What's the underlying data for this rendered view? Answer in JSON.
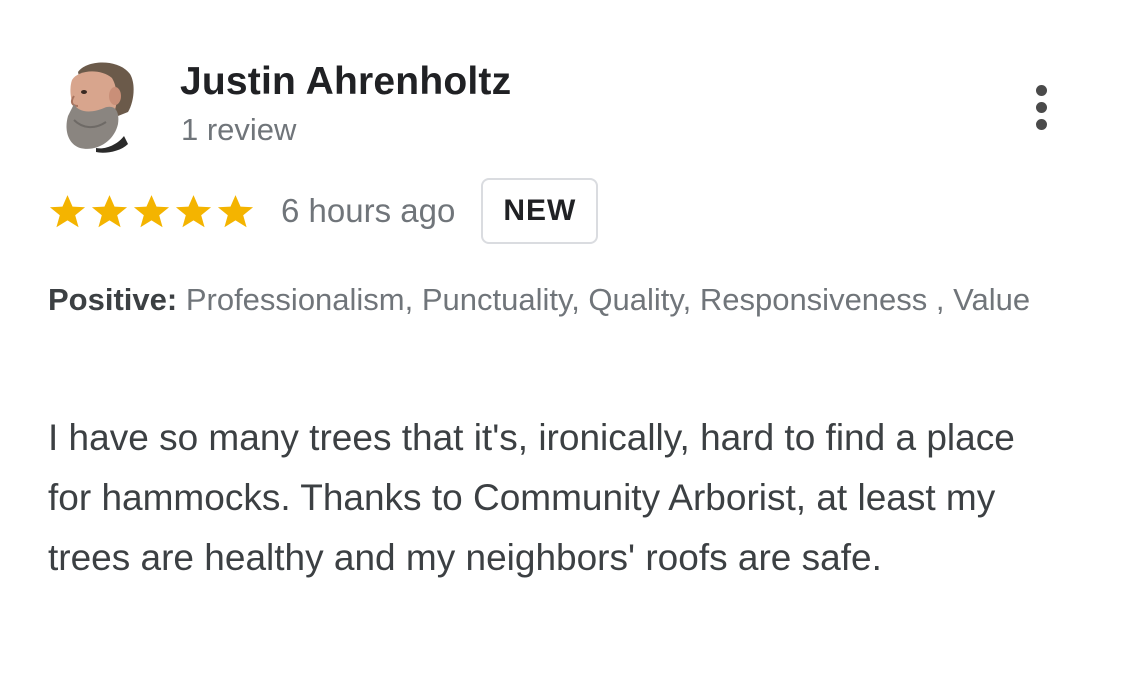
{
  "reviewer": {
    "name": "Justin Ahrenholtz",
    "review_count": "1 review"
  },
  "rating": {
    "stars": 5,
    "max_stars": 5,
    "star_color": "#f4b400",
    "time": "6 hours ago",
    "badge": "NEW"
  },
  "attributes": {
    "label": "Positive:",
    "values": " Professionalism, Punctuality, Quality, Responsiveness , Value"
  },
  "review": {
    "text": "I have so many trees that it's, ironically, hard to find a place for hammocks. Thanks to Community Arborist, at least my trees are healthy and my neighbors' roofs are safe."
  },
  "icons": {
    "more": "more-vert-icon",
    "star": "star-icon"
  }
}
